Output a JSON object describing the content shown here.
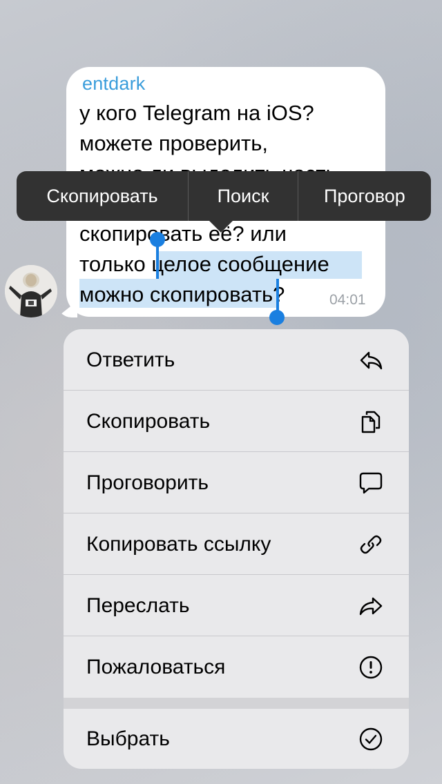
{
  "message": {
    "sender": "entdark",
    "lines": [
      "у кого Telegram на iOS?",
      "можете проверить,",
      "можно ли выделить часть",
      "скопировать её? или",
      "только целое сообщение",
      "можно скопировать?"
    ],
    "time": "04:01"
  },
  "toolbar": {
    "items": [
      "Скопировать",
      "Поиск",
      "Проговор"
    ]
  },
  "menu": {
    "items": [
      {
        "label": "Ответить",
        "icon": "reply-icon"
      },
      {
        "label": "Скопировать",
        "icon": "copy-icon"
      },
      {
        "label": "Проговорить",
        "icon": "speech-bubble-icon"
      },
      {
        "label": "Копировать ссылку",
        "icon": "link-icon"
      },
      {
        "label": "Переслать",
        "icon": "forward-icon"
      },
      {
        "label": "Пожаловаться",
        "icon": "report-icon"
      },
      {
        "label": "Выбрать",
        "icon": "checkmark-circle-icon"
      }
    ]
  },
  "colors": {
    "accent": "#1a7fe0",
    "sender": "#3a9ddb",
    "selection": "#cde4f7",
    "toolbar": "#323232"
  }
}
